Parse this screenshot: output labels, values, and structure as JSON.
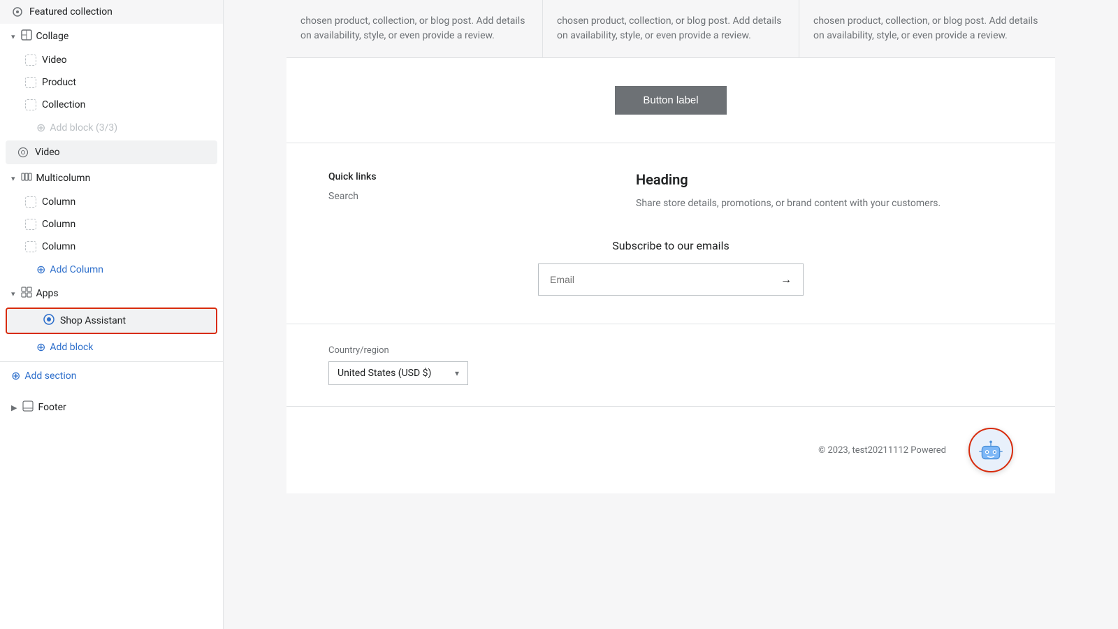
{
  "sidebar": {
    "featured_collection": "Featured collection",
    "collage": "Collage",
    "video_block": "Video",
    "product_block": "Product",
    "collection_block": "Collection",
    "add_block_33": "Add block (3/3)",
    "video_section": "Video",
    "multicolumn": "Multicolumn",
    "column1": "Column",
    "column2": "Column",
    "column3": "Column",
    "add_column": "Add Column",
    "apps": "Apps",
    "shop_assistant": "Shop Assistant",
    "add_block": "Add block",
    "add_section": "Add section",
    "footer": "Footer"
  },
  "main": {
    "card_text": "chosen product, collection, or blog post. Add details on availability, style, or even provide a review.",
    "button_label": "Button label",
    "quick_links": "Quick links",
    "search": "Search",
    "heading": "Heading",
    "heading_desc": "Share store details, promotions, or brand content with your customers.",
    "subscribe_title": "Subscribe to our emails",
    "email_placeholder": "Email",
    "country_label": "Country/region",
    "country_value": "United States (USD $)",
    "copyright": "© 2023, test20211112 Powered"
  }
}
